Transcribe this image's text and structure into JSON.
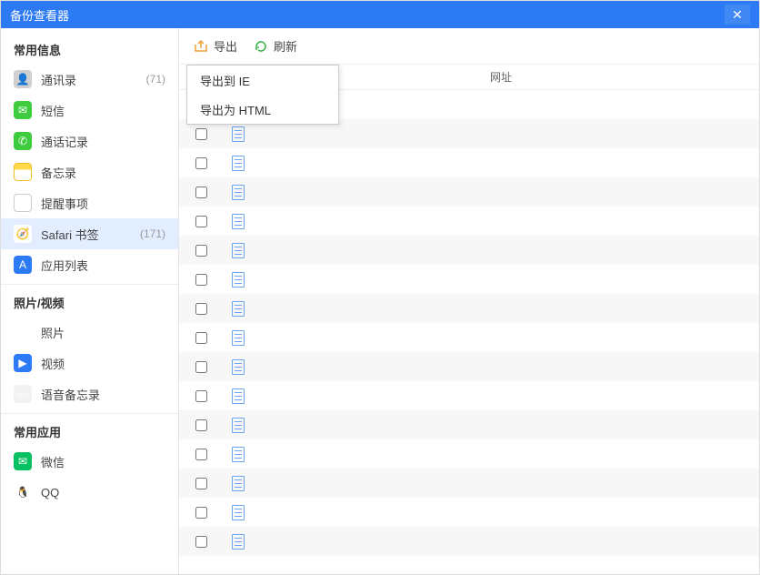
{
  "window": {
    "title": "备份查看器"
  },
  "sidebar": {
    "sections": [
      {
        "header": "常用信息",
        "items": [
          {
            "id": "contacts",
            "label": "通讯录",
            "count": "(71)",
            "icon": "contacts-icon",
            "iconClass": "ic-contacts",
            "glyph": "👤"
          },
          {
            "id": "sms",
            "label": "短信",
            "count": "",
            "icon": "sms-icon",
            "iconClass": "ic-sms",
            "glyph": "✉"
          },
          {
            "id": "calls",
            "label": "通话记录",
            "count": "",
            "icon": "calls-icon",
            "iconClass": "ic-call",
            "glyph": "✆"
          },
          {
            "id": "notes",
            "label": "备忘录",
            "count": "",
            "icon": "notes-icon",
            "iconClass": "ic-notes",
            "glyph": ""
          },
          {
            "id": "reminders",
            "label": "提醒事项",
            "count": "",
            "icon": "reminders-icon",
            "iconClass": "ic-reminders",
            "glyph": "☰"
          },
          {
            "id": "safari",
            "label": "Safari 书签",
            "count": "(171)",
            "icon": "safari-icon",
            "iconClass": "ic-safari",
            "glyph": "🧭",
            "selected": true
          },
          {
            "id": "apps",
            "label": "应用列表",
            "count": "",
            "icon": "apps-icon",
            "iconClass": "ic-apps",
            "glyph": "A"
          }
        ]
      },
      {
        "header": "照片/视频",
        "items": [
          {
            "id": "photos",
            "label": "照片",
            "count": "",
            "icon": "photos-icon",
            "iconClass": "ic-photos",
            "glyph": "✿"
          },
          {
            "id": "videos",
            "label": "视频",
            "count": "",
            "icon": "videos-icon",
            "iconClass": "ic-videos",
            "glyph": "▶"
          },
          {
            "id": "voice",
            "label": "语音备忘录",
            "count": "",
            "icon": "voice-icon",
            "iconClass": "ic-voice",
            "glyph": "〰"
          }
        ]
      },
      {
        "header": "常用应用",
        "items": [
          {
            "id": "wechat",
            "label": "微信",
            "count": "",
            "icon": "wechat-icon",
            "iconClass": "ic-wechat",
            "glyph": "✉"
          },
          {
            "id": "qq",
            "label": "QQ",
            "count": "",
            "icon": "qq-icon",
            "iconClass": "ic-qq",
            "glyph": "🐧"
          }
        ]
      }
    ]
  },
  "toolbar": {
    "export_label": "导出",
    "refresh_label": "刷新",
    "dropdown": {
      "export_ie": "导出到 IE",
      "export_html": "导出为 HTML"
    }
  },
  "columns": {
    "url": "网址"
  },
  "list": {
    "row_count": 16
  },
  "colors": {
    "accent": "#2d7bf4",
    "arrow": "#ff1a1a"
  }
}
